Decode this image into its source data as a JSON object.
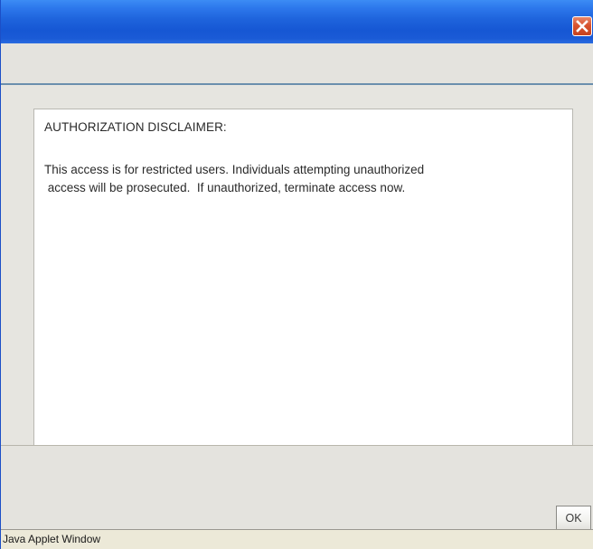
{
  "window": {
    "title": "",
    "close_icon": "close-icon"
  },
  "message": {
    "heading": "AUTHORIZATION DISCLAIMER:",
    "lines": [
      "This access is for restricted users. Individuals attempting unauthorized",
      " access will be prosecuted.  If unauthorized, terminate access now."
    ]
  },
  "buttons": {
    "ok_label": "OK"
  },
  "status_bar": {
    "text": "Java Applet Window"
  },
  "colors": {
    "titlebar_blue": "#1657d4",
    "close_red": "#d8532f",
    "dialog_bg": "#e4e3de",
    "panel_bg": "#ffffff"
  }
}
